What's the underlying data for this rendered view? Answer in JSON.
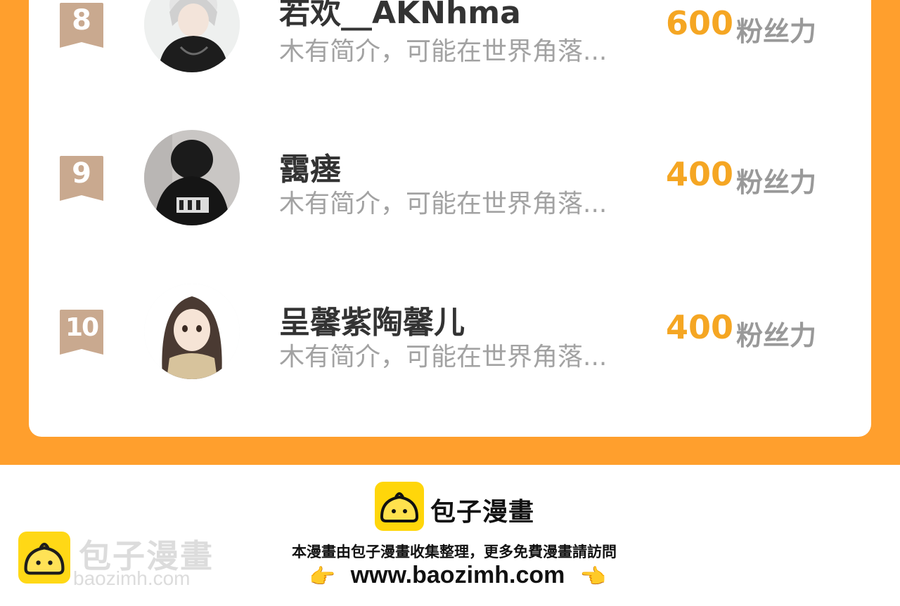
{
  "ranking": [
    {
      "rank": "8",
      "name": "若欢__AKNhma",
      "bio": "木有简介，可能在世界角落...",
      "score": "600",
      "unit": "粉丝力",
      "avatar": "anime-boy-hoodie-avatar"
    },
    {
      "rank": "9",
      "name": "靄瘗",
      "bio": "木有简介，可能在世界角落...",
      "score": "400",
      "unit": "粉丝力",
      "avatar": "black-hoodie-avatar"
    },
    {
      "rank": "10",
      "name": "呈馨紫陶馨儿",
      "bio": "木有简介，可能在世界角落...",
      "score": "400",
      "unit": "粉丝力",
      "avatar": "anime-girl-scarf-avatar"
    }
  ],
  "footer": {
    "brand": "包子漫畫",
    "notice": "本漫畫由包子漫畫收集整理，更多免費漫畫請訪問",
    "url": "www.baozimh.com",
    "hand_left": "👉",
    "hand_right": "👈"
  },
  "watermark": {
    "title": "包子漫畫",
    "url": "baozimh.com"
  },
  "colors": {
    "orange_bg": "#FF9F2D",
    "score": "#F5A623",
    "badge": "#C9A98F",
    "logo_yellow": "#FFD60A"
  }
}
